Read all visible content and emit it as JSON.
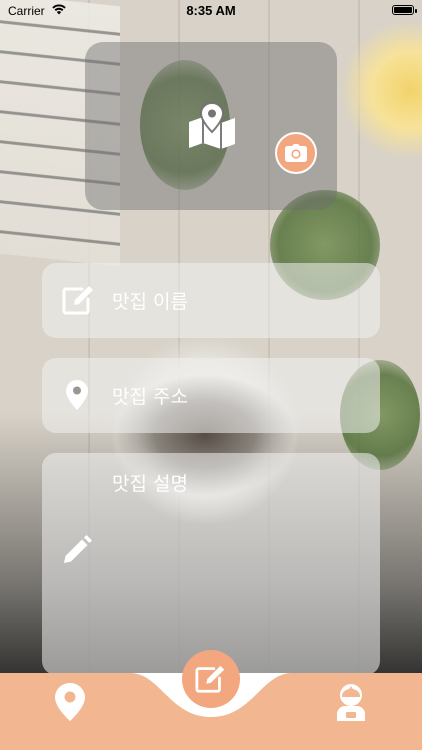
{
  "status_bar": {
    "carrier": "Carrier",
    "time": "8:35 AM"
  },
  "form": {
    "name_placeholder": "맛집 이름",
    "address_placeholder": "맛집 주소",
    "description_placeholder": "맛집 설명"
  },
  "icons": {
    "photo_card": "map-icon",
    "camera": "camera-icon",
    "name": "edit-icon",
    "address": "location-pin-icon",
    "description": "pencil-icon",
    "tab_left": "location-pin-icon",
    "tab_center": "edit-icon",
    "tab_right": "profile-icon"
  },
  "colors": {
    "accent": "#f2a77e",
    "tabbar": "#f2b791",
    "field_bg": "rgba(240,240,240,0.55)",
    "text": "#ffffff"
  }
}
